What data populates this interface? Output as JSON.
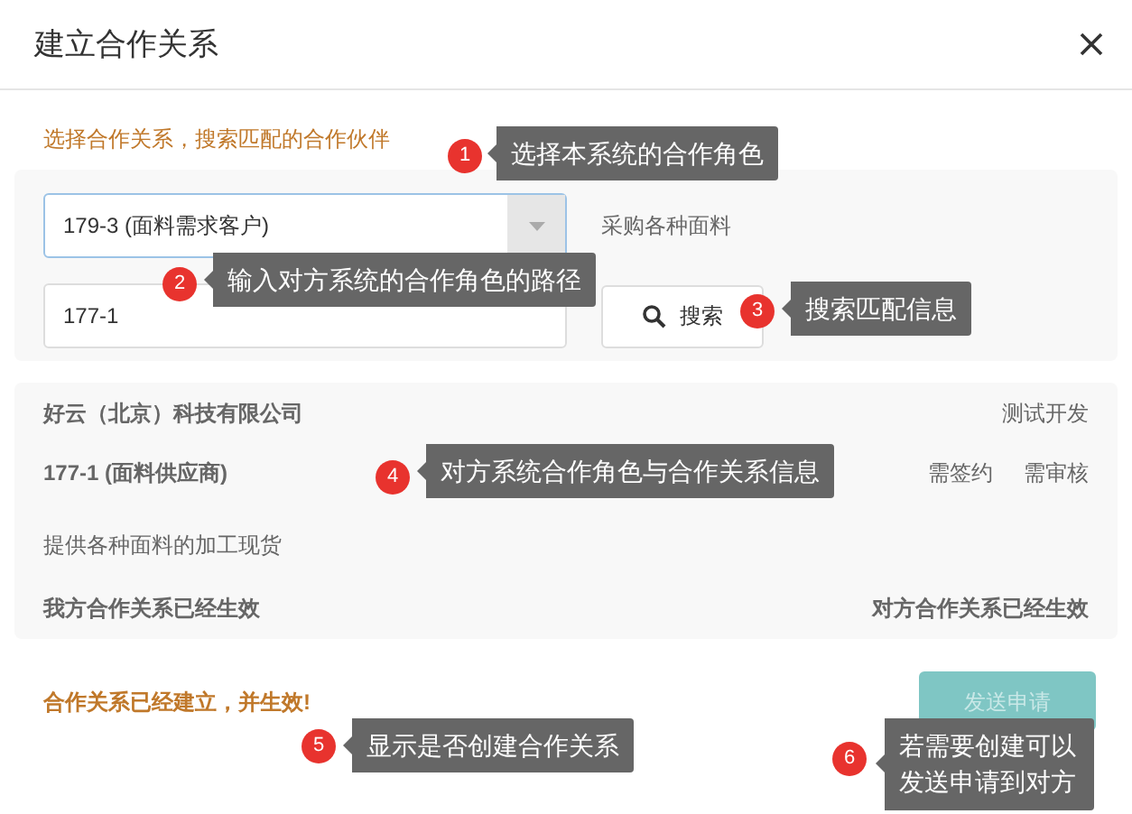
{
  "dialog": {
    "title": "建立合作关系"
  },
  "hint": "选择合作关系，搜索匹配的合作伙伴",
  "role_select": {
    "value": "179-3 (面料需求客户)"
  },
  "role_note": "采购各种面料",
  "path_input": {
    "value": "177-1"
  },
  "search_button": {
    "label": "搜索"
  },
  "partner": {
    "company": "好云（北京）科技有限公司",
    "tag": "测试开发",
    "role": "177-1 (面料供应商)",
    "flags": [
      "需签约",
      "需审核"
    ],
    "description": "提供各种面料的加工现货",
    "our_status": "我方合作关系已经生效",
    "their_status": "对方合作关系已经生效"
  },
  "result_message": "合作关系已经建立，并生效!",
  "send_button": {
    "label": "发送申请",
    "disabled": true
  },
  "callouts": [
    {
      "number": "1",
      "text": "选择本系统的合作角色"
    },
    {
      "number": "2",
      "text": "输入对方系统的合作角色的路径"
    },
    {
      "number": "3",
      "text": "搜索匹配信息"
    },
    {
      "number": "4",
      "text": "对方系统合作角色与合作关系信息"
    },
    {
      "number": "5",
      "text": "显示是否创建合作关系"
    },
    {
      "number": "6",
      "text": "若需要创建可以发送申请到对方"
    }
  ]
}
